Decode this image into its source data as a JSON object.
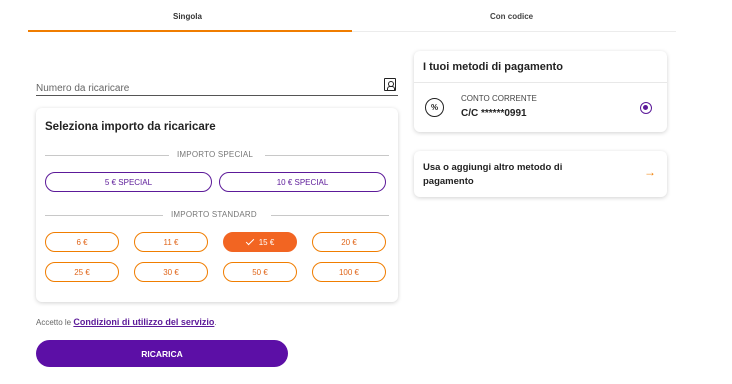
{
  "tabs": {
    "single": "Singola",
    "code": "Con codice"
  },
  "phone": {
    "placeholder": "Numero da ricaricare",
    "value": ""
  },
  "amount": {
    "title": "Seleziona importo da ricaricare",
    "special_label": "IMPORTO SPECIAL",
    "standard_label": "IMPORTO STANDARD",
    "special": [
      "5 € SPECIAL",
      "10 € SPECIAL"
    ],
    "standard": [
      "6 €",
      "11 €",
      "15 €",
      "20 €",
      "25 €",
      "30 €",
      "50 €",
      "100 €"
    ],
    "selected": "15 €"
  },
  "terms": {
    "prefix": "Accetto le",
    "link": "Condizioni di utilizzo del servizio",
    "suffix": "."
  },
  "submit_label": "RICARICA",
  "methods": {
    "title": "I tuoi metodi di pagamento",
    "item": {
      "icon": "percent-icon",
      "type": "CONTO CORRENTE",
      "number": "C/C ******0991"
    }
  },
  "add_method": {
    "label": "Usa o aggiungi altro metodo di pagamento",
    "icon": "arrow-right-icon"
  },
  "colors": {
    "accent_orange": "#f07d00",
    "selected_orange": "#f26522",
    "brand_purple": "#5c0fa6"
  }
}
